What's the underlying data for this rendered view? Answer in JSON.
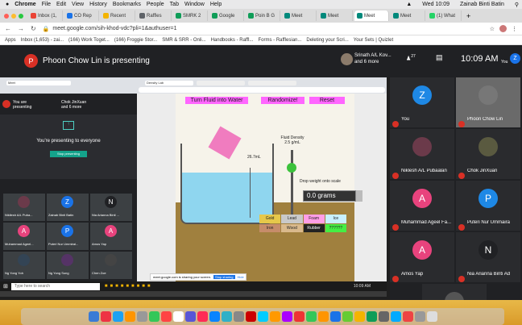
{
  "menubar": {
    "app": "Chrome",
    "items": [
      "File",
      "Edit",
      "View",
      "History",
      "Bookmarks",
      "People",
      "Tab",
      "Window",
      "Help"
    ],
    "clock": "Wed 10:09",
    "user": "Zainab Binti Batin"
  },
  "tabs": [
    {
      "label": "Inbox (1,",
      "color": "#ea4335"
    },
    {
      "label": "CO Rep",
      "color": "#1a73e8"
    },
    {
      "label": "Recent",
      "color": "#f4b400"
    },
    {
      "label": "Raffles",
      "color": "#5f6368"
    },
    {
      "label": "SMRK 2",
      "color": "#0f9d58"
    },
    {
      "label": "Google",
      "color": "#0f9d58"
    },
    {
      "label": "Poin B G",
      "color": "#0f9d58"
    },
    {
      "label": "Meet",
      "color": "#00897b"
    },
    {
      "label": "Meet",
      "color": "#00897b"
    },
    {
      "label": "Meet",
      "color": "#00897b"
    },
    {
      "label": "Meet",
      "color": "#00897b"
    },
    {
      "label": "(1) What",
      "color": "#25d366"
    }
  ],
  "address": {
    "url": "meet.google.com/sih-khod-vdc?pli=1&authuser=1"
  },
  "bookmarks": [
    "Apps",
    "Inbox (1,653) - zai...",
    "(166) Work Toget...",
    "(166) Froggie Stor...",
    "SMR & SRR - Onli...",
    "Handbooks - Raffl...",
    "Forms - Rafflesian...",
    "Deleting your Scri...",
    "Your Sets | Quizlet"
  ],
  "meet": {
    "presenter_initial": "P",
    "presenting": "Phoon Chow Lin is presenting",
    "room_name": "Srinath A/L Kov...",
    "room_sub": "and 6 more",
    "count": "27",
    "time": "10:09 AM",
    "you": "You",
    "user_initial": "Z"
  },
  "shared": {
    "mini_title": "You are presenting",
    "mini_chip": "Chok JinXuan and 6 more",
    "present_msg": "You're presenting to everyone",
    "stop_btn": "Stop presenting",
    "sim_buttons": [
      "Turn Fluid into Water",
      "Randomize!",
      "Reset"
    ],
    "fluid_density_label": "Fluid Density",
    "fluid_density_value": "2.5 g/mL",
    "volume_label": "26.7mL",
    "drop_label": "Drop weight onto scale",
    "scale_value": "0.0 grams",
    "materials": [
      "Gold",
      "Lead",
      "Foam",
      "Ice",
      "Iron",
      "Wood",
      "Rubber",
      "??????"
    ],
    "mini_participants": [
      {
        "name": "Nikllesh A/L Puba...",
        "initial": "",
        "color": "#6b3a4a"
      },
      {
        "name": "Zainab Binti Batin",
        "initial": "Z",
        "color": "#1a73e8"
      },
      {
        "name": "Nia Arianna Binti ...",
        "initial": "N",
        "color": "#202124"
      },
      {
        "name": "Muhammad Ageel...",
        "initial": "A",
        "color": "#e8437d"
      },
      {
        "name": "Puteri Nur Ummirai...",
        "initial": "P",
        "color": "#1a73e8"
      },
      {
        "name": "Amos Yap",
        "initial": "A",
        "color": "#e8437d"
      },
      {
        "name": "Ng Yong Yoh",
        "initial": "",
        "color": "#345"
      },
      {
        "name": "Ng Yong Sung",
        "initial": "",
        "color": "#536"
      },
      {
        "name": "Chen Zoe",
        "initial": "",
        "color": "#444"
      }
    ],
    "share_bar": "meet.google.com is sharing your screen.",
    "share_stop": "Stop sharing",
    "share_hide": "Hide",
    "search_placeholder": "Type here to search",
    "tray_time": "10:09 AM"
  },
  "participants": [
    {
      "name": "You",
      "initial": "Z",
      "color": "#1e88e5"
    },
    {
      "name": "Phoon Chow Lin",
      "initial": "",
      "color": "#777"
    },
    {
      "name": "Niklesh A/L Pubaalan",
      "initial": "",
      "color": "#6b3a4a"
    },
    {
      "name": "Chok JinXuan",
      "initial": "",
      "color": "#5a5a40"
    },
    {
      "name": "Muhammad Ageel Fa...",
      "initial": "A",
      "color": "#e8437d"
    },
    {
      "name": "Puteri Nur Ummaira",
      "initial": "P",
      "color": "#1e88e5"
    },
    {
      "name": "Amos Yap",
      "initial": "A",
      "color": "#e8437d"
    },
    {
      "name": "Nia Arianna Binti Ad",
      "initial": "N",
      "color": "#202124"
    },
    {
      "name": "Chen Zoe",
      "initial": "",
      "color": "#555"
    }
  ],
  "colors": {
    "meet_bg": "#202124",
    "meet_red": "#d93025",
    "meet_blue": "#1a73e8"
  }
}
